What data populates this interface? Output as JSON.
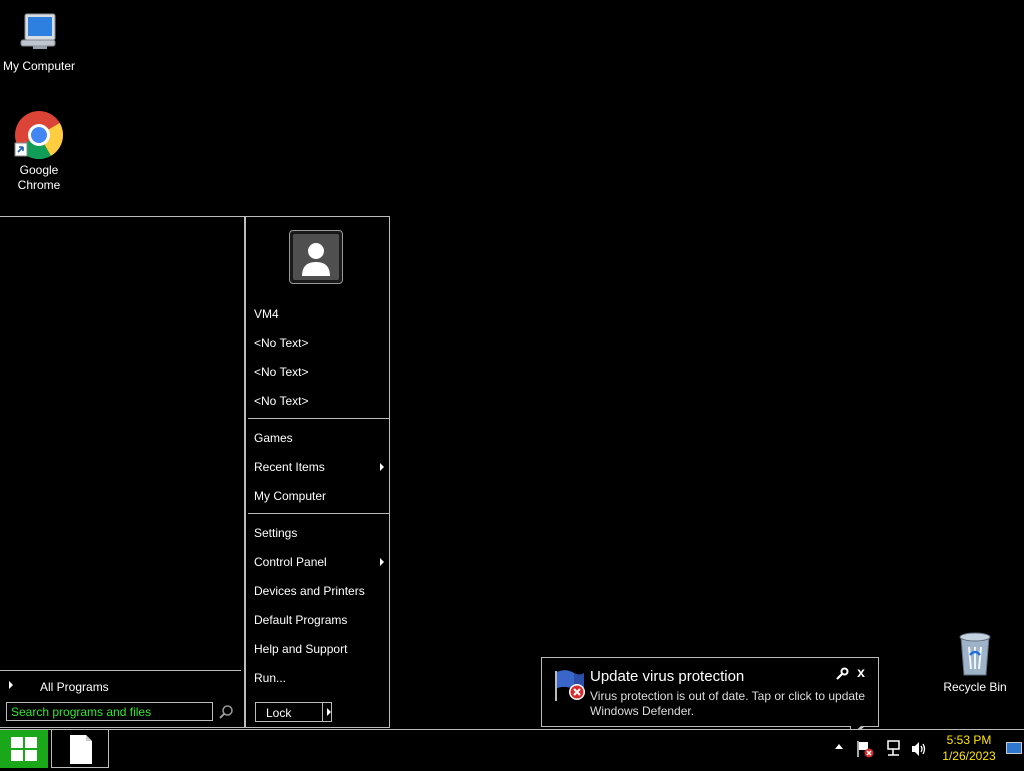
{
  "desktop": {
    "icons": [
      {
        "label": "My Computer",
        "icon": "computer-icon"
      },
      {
        "label": "Google Chrome",
        "icon": "chrome-icon"
      },
      {
        "label": "Recycle Bin",
        "icon": "recycle-bin-icon"
      }
    ],
    "colors": {
      "background": "#000000"
    }
  },
  "start_menu": {
    "all_programs_label": "All Programs",
    "search_placeholder": "Search programs and files",
    "user_items": [
      "VM4",
      "<No Text>",
      "<No Text>",
      "<No Text>"
    ],
    "group2": [
      {
        "label": "Games",
        "has_submenu": false
      },
      {
        "label": "Recent Items",
        "has_submenu": true
      },
      {
        "label": "My Computer",
        "has_submenu": false
      }
    ],
    "group3": [
      {
        "label": "Settings",
        "has_submenu": false
      },
      {
        "label": "Control Panel",
        "has_submenu": true
      },
      {
        "label": "Devices and Printers",
        "has_submenu": false
      },
      {
        "label": "Default Programs",
        "has_submenu": false
      },
      {
        "label": "Help and Support",
        "has_submenu": false
      },
      {
        "label": "Run...",
        "has_submenu": false
      }
    ],
    "power_button_label": "Lock",
    "colors": {
      "search_text": "#2ee82e",
      "border": "#bcbcbc"
    }
  },
  "notification": {
    "title": "Update virus protection",
    "body": "Virus protection is out of date. Tap or click to update Windows Defender.",
    "close_label": "x"
  },
  "taskbar": {
    "clock": {
      "time": "5:53 PM",
      "date": "1/26/2023"
    },
    "colors": {
      "start_button": "#1aa81a",
      "clock_text": "#ffe600"
    }
  }
}
